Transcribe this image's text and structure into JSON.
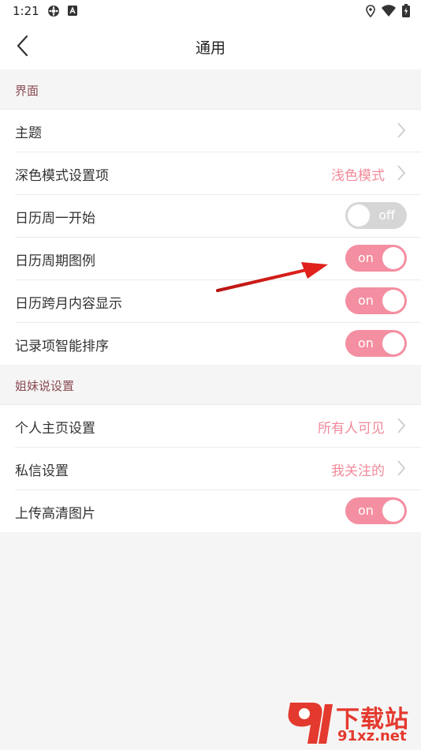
{
  "status_bar": {
    "time": "1:21",
    "left_icons": [
      "gear-icon",
      "a-icon"
    ],
    "right_icons": [
      "location-icon",
      "wifi-icon",
      "battery-icon"
    ]
  },
  "header": {
    "title": "通用",
    "back_icon": "chevron-left-icon"
  },
  "sections": [
    {
      "title": "界面",
      "rows": [
        {
          "label": "主题",
          "type": "nav",
          "value": ""
        },
        {
          "label": "深色模式设置项",
          "type": "nav",
          "value": "浅色模式"
        },
        {
          "label": "日历周一开始",
          "type": "toggle",
          "state": "off"
        },
        {
          "label": "日历周期图例",
          "type": "toggle",
          "state": "on"
        },
        {
          "label": "日历跨月内容显示",
          "type": "toggle",
          "state": "on"
        },
        {
          "label": "记录项智能排序",
          "type": "toggle",
          "state": "on"
        }
      ]
    },
    {
      "title": "姐妹说设置",
      "rows": [
        {
          "label": "个人主页设置",
          "type": "nav",
          "value": "所有人可见"
        },
        {
          "label": "私信设置",
          "type": "nav",
          "value": "我关注的"
        },
        {
          "label": "上传高清图片",
          "type": "toggle",
          "state": "on"
        }
      ]
    }
  ],
  "toggle_labels": {
    "on": "on",
    "off": "off"
  },
  "colors": {
    "accent": "#f48ea1",
    "value_text": "#f28a9a",
    "section_title": "#8a4b52",
    "toggle_off": "#d6d6d6",
    "annotation_arrow": "#e0211c"
  },
  "watermark": {
    "title": "下载站",
    "domain": "91xz.net"
  }
}
